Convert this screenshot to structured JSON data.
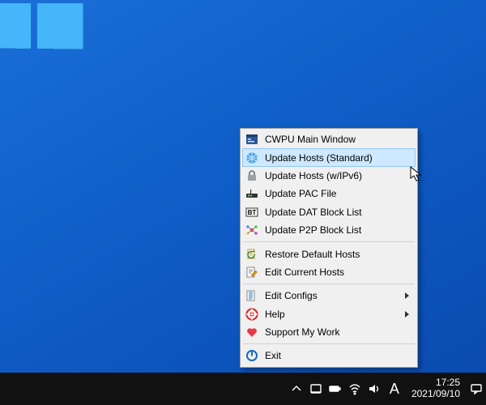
{
  "menu": {
    "items": [
      {
        "label": "CWPU Main Window",
        "icon": "app-window-icon",
        "submenu": false,
        "hover": false
      },
      {
        "label": "Update Hosts (Standard)",
        "icon": "globe-icon",
        "submenu": false,
        "hover": true
      },
      {
        "label": "Update Hosts (w/IPv6)",
        "icon": "lock-icon",
        "submenu": false,
        "hover": false
      },
      {
        "label": "Update PAC File",
        "icon": "pac-icon",
        "submenu": false,
        "hover": false
      },
      {
        "label": "Update DAT Block List",
        "icon": "bt-icon",
        "submenu": false,
        "hover": false
      },
      {
        "label": "Update P2P Block List",
        "icon": "p2p-icon",
        "submenu": false,
        "hover": false
      },
      {
        "sep": true
      },
      {
        "label": "Restore Default Hosts",
        "icon": "restore-icon",
        "submenu": false,
        "hover": false
      },
      {
        "label": "Edit Current Hosts",
        "icon": "edit-icon",
        "submenu": false,
        "hover": false
      },
      {
        "sep": true
      },
      {
        "label": "Edit Configs",
        "icon": "configs-icon",
        "submenu": true,
        "hover": false
      },
      {
        "label": "Help",
        "icon": "help-icon",
        "submenu": true,
        "hover": false
      },
      {
        "label": "Support My Work",
        "icon": "heart-icon",
        "submenu": false,
        "hover": false
      },
      {
        "sep": true
      },
      {
        "label": "Exit",
        "icon": "exit-icon",
        "submenu": false,
        "hover": false
      }
    ]
  },
  "taskbar": {
    "ime": "A",
    "time": "17:25",
    "date": "2021/09/10"
  }
}
